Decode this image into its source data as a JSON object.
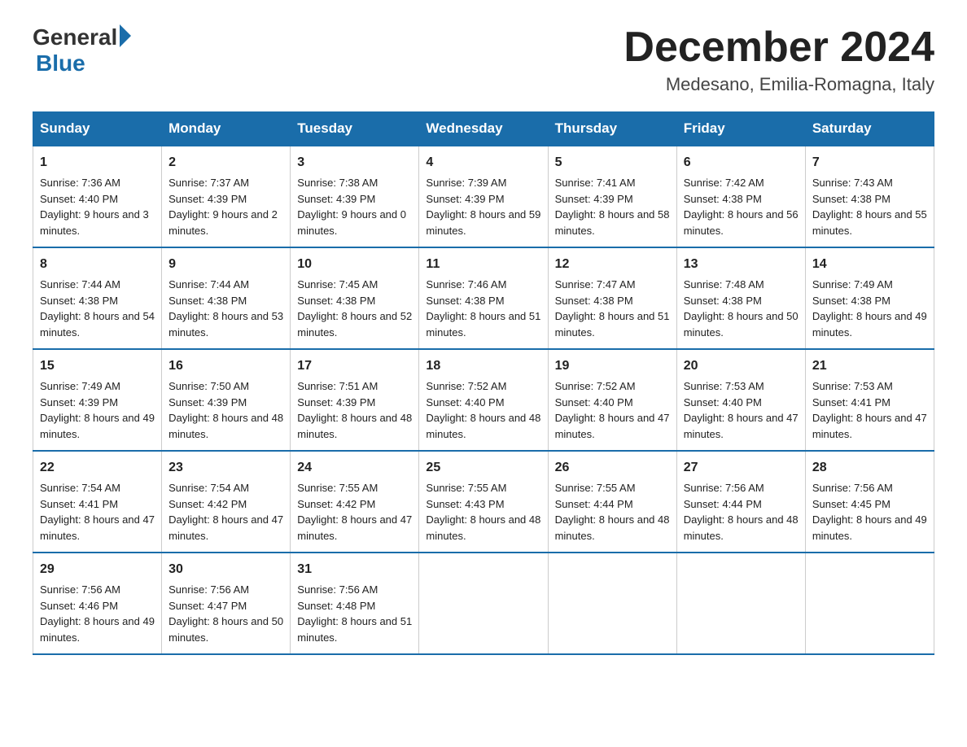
{
  "header": {
    "logo_general": "General",
    "logo_blue": "Blue",
    "month_title": "December 2024",
    "location": "Medesano, Emilia-Romagna, Italy"
  },
  "days_of_week": [
    "Sunday",
    "Monday",
    "Tuesday",
    "Wednesday",
    "Thursday",
    "Friday",
    "Saturday"
  ],
  "weeks": [
    [
      {
        "day": "1",
        "sunrise": "Sunrise: 7:36 AM",
        "sunset": "Sunset: 4:40 PM",
        "daylight": "Daylight: 9 hours and 3 minutes."
      },
      {
        "day": "2",
        "sunrise": "Sunrise: 7:37 AM",
        "sunset": "Sunset: 4:39 PM",
        "daylight": "Daylight: 9 hours and 2 minutes."
      },
      {
        "day": "3",
        "sunrise": "Sunrise: 7:38 AM",
        "sunset": "Sunset: 4:39 PM",
        "daylight": "Daylight: 9 hours and 0 minutes."
      },
      {
        "day": "4",
        "sunrise": "Sunrise: 7:39 AM",
        "sunset": "Sunset: 4:39 PM",
        "daylight": "Daylight: 8 hours and 59 minutes."
      },
      {
        "day": "5",
        "sunrise": "Sunrise: 7:41 AM",
        "sunset": "Sunset: 4:39 PM",
        "daylight": "Daylight: 8 hours and 58 minutes."
      },
      {
        "day": "6",
        "sunrise": "Sunrise: 7:42 AM",
        "sunset": "Sunset: 4:38 PM",
        "daylight": "Daylight: 8 hours and 56 minutes."
      },
      {
        "day": "7",
        "sunrise": "Sunrise: 7:43 AM",
        "sunset": "Sunset: 4:38 PM",
        "daylight": "Daylight: 8 hours and 55 minutes."
      }
    ],
    [
      {
        "day": "8",
        "sunrise": "Sunrise: 7:44 AM",
        "sunset": "Sunset: 4:38 PM",
        "daylight": "Daylight: 8 hours and 54 minutes."
      },
      {
        "day": "9",
        "sunrise": "Sunrise: 7:44 AM",
        "sunset": "Sunset: 4:38 PM",
        "daylight": "Daylight: 8 hours and 53 minutes."
      },
      {
        "day": "10",
        "sunrise": "Sunrise: 7:45 AM",
        "sunset": "Sunset: 4:38 PM",
        "daylight": "Daylight: 8 hours and 52 minutes."
      },
      {
        "day": "11",
        "sunrise": "Sunrise: 7:46 AM",
        "sunset": "Sunset: 4:38 PM",
        "daylight": "Daylight: 8 hours and 51 minutes."
      },
      {
        "day": "12",
        "sunrise": "Sunrise: 7:47 AM",
        "sunset": "Sunset: 4:38 PM",
        "daylight": "Daylight: 8 hours and 51 minutes."
      },
      {
        "day": "13",
        "sunrise": "Sunrise: 7:48 AM",
        "sunset": "Sunset: 4:38 PM",
        "daylight": "Daylight: 8 hours and 50 minutes."
      },
      {
        "day": "14",
        "sunrise": "Sunrise: 7:49 AM",
        "sunset": "Sunset: 4:38 PM",
        "daylight": "Daylight: 8 hours and 49 minutes."
      }
    ],
    [
      {
        "day": "15",
        "sunrise": "Sunrise: 7:49 AM",
        "sunset": "Sunset: 4:39 PM",
        "daylight": "Daylight: 8 hours and 49 minutes."
      },
      {
        "day": "16",
        "sunrise": "Sunrise: 7:50 AM",
        "sunset": "Sunset: 4:39 PM",
        "daylight": "Daylight: 8 hours and 48 minutes."
      },
      {
        "day": "17",
        "sunrise": "Sunrise: 7:51 AM",
        "sunset": "Sunset: 4:39 PM",
        "daylight": "Daylight: 8 hours and 48 minutes."
      },
      {
        "day": "18",
        "sunrise": "Sunrise: 7:52 AM",
        "sunset": "Sunset: 4:40 PM",
        "daylight": "Daylight: 8 hours and 48 minutes."
      },
      {
        "day": "19",
        "sunrise": "Sunrise: 7:52 AM",
        "sunset": "Sunset: 4:40 PM",
        "daylight": "Daylight: 8 hours and 47 minutes."
      },
      {
        "day": "20",
        "sunrise": "Sunrise: 7:53 AM",
        "sunset": "Sunset: 4:40 PM",
        "daylight": "Daylight: 8 hours and 47 minutes."
      },
      {
        "day": "21",
        "sunrise": "Sunrise: 7:53 AM",
        "sunset": "Sunset: 4:41 PM",
        "daylight": "Daylight: 8 hours and 47 minutes."
      }
    ],
    [
      {
        "day": "22",
        "sunrise": "Sunrise: 7:54 AM",
        "sunset": "Sunset: 4:41 PM",
        "daylight": "Daylight: 8 hours and 47 minutes."
      },
      {
        "day": "23",
        "sunrise": "Sunrise: 7:54 AM",
        "sunset": "Sunset: 4:42 PM",
        "daylight": "Daylight: 8 hours and 47 minutes."
      },
      {
        "day": "24",
        "sunrise": "Sunrise: 7:55 AM",
        "sunset": "Sunset: 4:42 PM",
        "daylight": "Daylight: 8 hours and 47 minutes."
      },
      {
        "day": "25",
        "sunrise": "Sunrise: 7:55 AM",
        "sunset": "Sunset: 4:43 PM",
        "daylight": "Daylight: 8 hours and 48 minutes."
      },
      {
        "day": "26",
        "sunrise": "Sunrise: 7:55 AM",
        "sunset": "Sunset: 4:44 PM",
        "daylight": "Daylight: 8 hours and 48 minutes."
      },
      {
        "day": "27",
        "sunrise": "Sunrise: 7:56 AM",
        "sunset": "Sunset: 4:44 PM",
        "daylight": "Daylight: 8 hours and 48 minutes."
      },
      {
        "day": "28",
        "sunrise": "Sunrise: 7:56 AM",
        "sunset": "Sunset: 4:45 PM",
        "daylight": "Daylight: 8 hours and 49 minutes."
      }
    ],
    [
      {
        "day": "29",
        "sunrise": "Sunrise: 7:56 AM",
        "sunset": "Sunset: 4:46 PM",
        "daylight": "Daylight: 8 hours and 49 minutes."
      },
      {
        "day": "30",
        "sunrise": "Sunrise: 7:56 AM",
        "sunset": "Sunset: 4:47 PM",
        "daylight": "Daylight: 8 hours and 50 minutes."
      },
      {
        "day": "31",
        "sunrise": "Sunrise: 7:56 AM",
        "sunset": "Sunset: 4:48 PM",
        "daylight": "Daylight: 8 hours and 51 minutes."
      },
      null,
      null,
      null,
      null
    ]
  ]
}
